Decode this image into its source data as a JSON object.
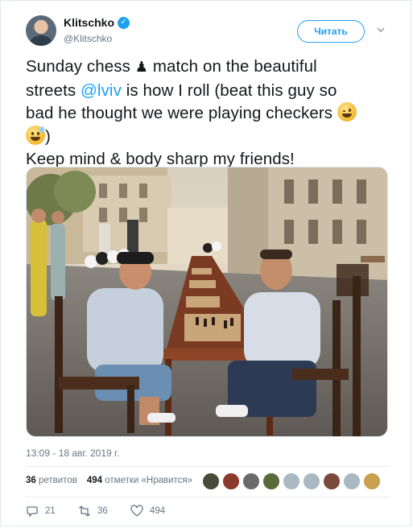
{
  "author": {
    "name": "Klitschko",
    "handle": "@Klitschko"
  },
  "follow_label": "Читать",
  "tweet": {
    "line1_a": "Sunday chess",
    "line1_b": "match on the beautiful",
    "line2_mention": "@lviv",
    "line2_rest": "is how I roll (beat this guy so",
    "line3": "bad he thought we were playing checkers",
    "line4": ")",
    "line5": "Keep mind & body sharp my friends!"
  },
  "timestamp": "13:09 - 18 авг. 2019 г.",
  "stats": {
    "retweets_count": "36",
    "retweets_label": "ретвитов",
    "likes_count": "494",
    "likes_label": "отметки «Нравится»"
  },
  "actions": {
    "replies": "21",
    "retweets": "36",
    "likes": "494"
  },
  "colors": {
    "accent": "#1da1f2",
    "secondary_text": "#657786"
  },
  "icons": [
    "verified-badge-icon",
    "chevron-down-icon",
    "chess-pawn-emoji",
    "winking-face-emoji",
    "grinning-sweat-emoji",
    "reply-icon",
    "retweet-icon",
    "like-heart-icon"
  ]
}
